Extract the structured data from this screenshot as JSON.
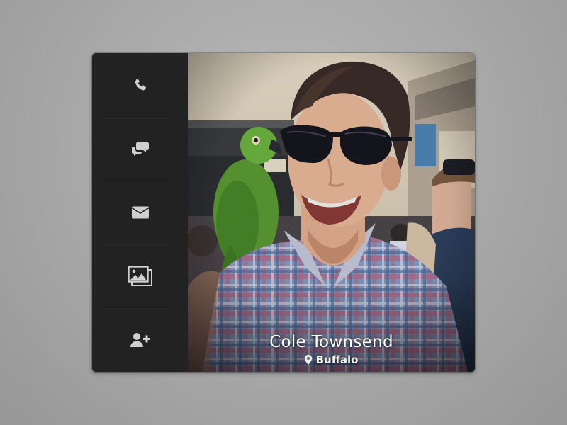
{
  "profile": {
    "name": "Cole Townsend",
    "location": "Buffalo"
  },
  "sidebar": {
    "items": [
      {
        "icon": "phone-icon"
      },
      {
        "icon": "chat-bubbles-icon"
      },
      {
        "icon": "envelope-icon"
      },
      {
        "icon": "photo-gallery-icon"
      },
      {
        "icon": "add-user-icon"
      }
    ]
  },
  "colors": {
    "sidebar_background": "#222222",
    "icon": "#cfcfcf",
    "page_background": "#a8a8a8",
    "caption_text": "#ffffff"
  }
}
